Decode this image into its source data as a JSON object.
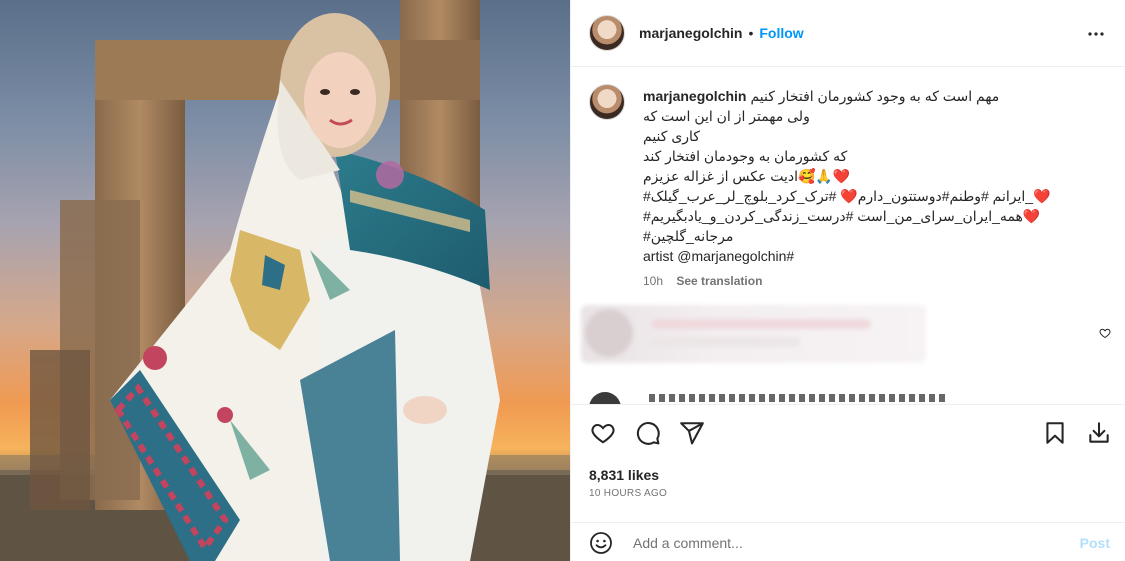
{
  "post": {
    "username": "marjanegolchin",
    "separator": "•",
    "follow_label": "Follow",
    "more_icon": "more-options-icon"
  },
  "caption": {
    "username": "marjanegolchin",
    "lines": [
      "مهم است که به وجود کشورمان افتخار کنیم",
      "ولی مهمتر از ان این است که",
      "کاری کنیم",
      "که کشورمان به وجودمان افتخار کند",
      "ادیت عکس از غزاله عزیزم🥰🙏❤️",
      "#ایرانم #وطنم#دوستتون_دارم❤️ #ترک_کرد_بلوچ_لر_عرب_گیلک_❤️",
      "#همه_ایران_سرای_من_است #درست_زندگی_کردن_و_یادبگیریم❤️",
      "#مرجانه_گلچین",
      "artist @marjanegolchin#"
    ],
    "age": "10h",
    "see_translation": "See translation"
  },
  "actions": {
    "like_icon": "heart-icon",
    "comment_icon": "comment-icon",
    "share_icon": "share-icon",
    "save_icon": "bookmark-icon",
    "download_icon": "download-icon"
  },
  "likes_label": "8,831 likes",
  "timestamp": "10 HOURS AGO",
  "comment_box": {
    "placeholder": "Add a comment...",
    "post_label": "Post",
    "emoji_icon": "emoji-icon"
  },
  "colors": {
    "follow": "#0095f6",
    "post_disabled": "#b2dffc",
    "meta": "#737373",
    "text": "#262626"
  }
}
